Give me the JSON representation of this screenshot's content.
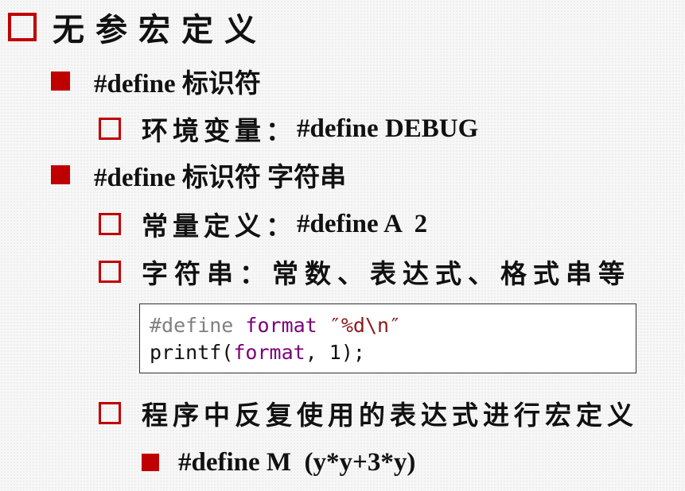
{
  "slide": {
    "title": "无参宏定义",
    "items": [
      {
        "id": "item1",
        "text": "#define 标识符"
      },
      {
        "id": "item1a",
        "label": "环境变量：",
        "code": "#define DEBUG"
      },
      {
        "id": "item2",
        "text": "#define 标识符 字符串"
      },
      {
        "id": "item2a",
        "label": "常量定义：",
        "code": "#define A  2"
      },
      {
        "id": "item2b",
        "text": "字符串：常数、表达式、格式串等"
      },
      {
        "id": "item2c",
        "text": "程序中反复使用的表达式进行宏定义"
      },
      {
        "id": "item2c1",
        "code": "#define M  (y*y+3*y)"
      }
    ],
    "code_example": {
      "line1": {
        "directive": "#define",
        "space1": " ",
        "macro": "format",
        "space2": " ",
        "string": "″%d\\n″"
      },
      "line2": {
        "fn": "printf(",
        "arg": "format",
        "rest": ", 1);"
      }
    }
  },
  "colors": {
    "bullet": "#c00000",
    "directive": "#808080",
    "macro": "#7a007a",
    "string": "#8b1a1a"
  }
}
